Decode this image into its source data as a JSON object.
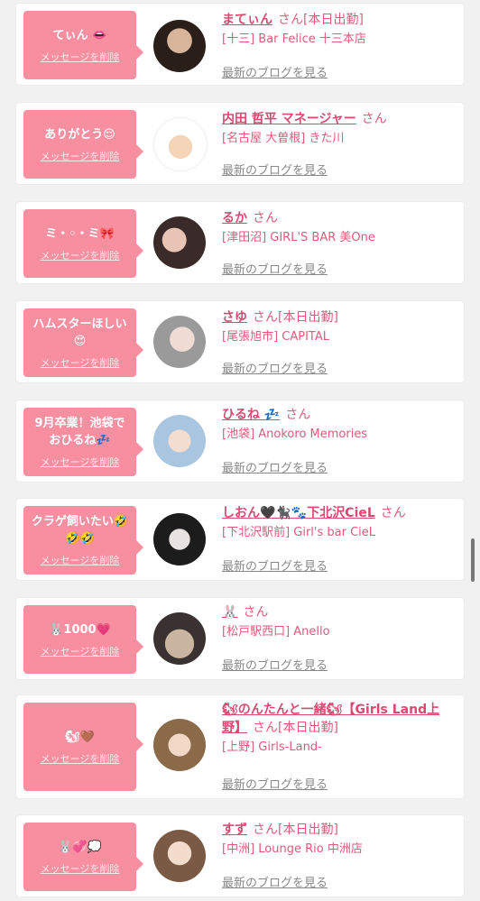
{
  "delete_label": "メッセージを削除",
  "blog_label": "最新のブログを見る",
  "cards": [
    {
      "message": "てぃん 👄",
      "name": "まてぃん",
      "suffix": "さん[本日出勤]",
      "shop": "[十三] Bar Felice 十三本店"
    },
    {
      "message": "ありがとう😌",
      "name": "内田 哲平 マネージャー",
      "suffix": "さん",
      "shop": "[名古屋 大曽根] きた川"
    },
    {
      "message": "ミ・◦・ミ🎀",
      "name": "るか",
      "suffix": "さん",
      "shop": "[津田沼] GIRL'S BAR 美One"
    },
    {
      "message": "ハムスターほしい\n😍",
      "name": "さゆ",
      "suffix": "さん[本日出勤]",
      "shop": "[尾張旭市] CAPITAL"
    },
    {
      "message": "9月卒業！池袋で\nおひるね💤",
      "name": "ひるね 💤",
      "suffix": "さん",
      "shop": "[池袋] Anokoro Memories"
    },
    {
      "message": "クラゲ飼いたい🤣\n🤣🤣",
      "name": "しおん🖤🐈‍⬛🐾下北沢CieL",
      "suffix": "さん",
      "shop": "[下北沢駅前] Girl's bar CieL"
    },
    {
      "message": "🐰1000💗",
      "name": "🐰",
      "suffix": "さん",
      "shop": "[松戸駅西口] Anello"
    },
    {
      "message": "🐿🤎",
      "name": "🐿のんたんと一緒🐿【Girls Land上野】",
      "suffix": "さん[本日出勤]",
      "shop": "[上野] Girls-Land-"
    },
    {
      "message": "🐰💞💭",
      "name": "すず",
      "suffix": "さん[本日出勤]",
      "shop": "[中洲] Lounge Rio 中洲店"
    }
  ]
}
